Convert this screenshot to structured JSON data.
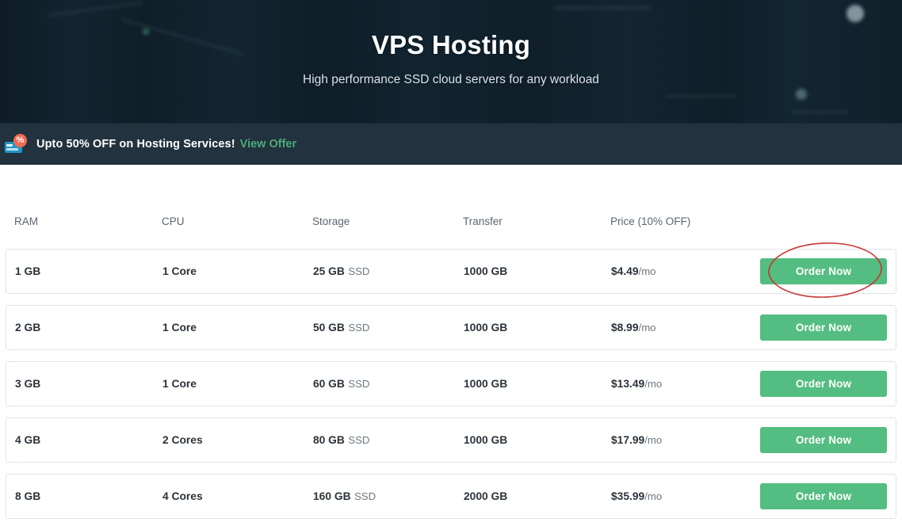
{
  "hero": {
    "title": "VPS Hosting",
    "subtitle": "High performance SSD cloud servers for any workload"
  },
  "promo": {
    "icon": "discount-card-icon",
    "text": "Upto 50% OFF on Hosting Services!",
    "link_label": "View Offer",
    "link_color": "#4aab7c"
  },
  "table": {
    "headers": {
      "ram": "RAM",
      "cpu": "CPU",
      "storage": "Storage",
      "transfer": "Transfer",
      "price": "Price (10% OFF)"
    },
    "rows": [
      {
        "ram": "1 GB",
        "cpu": "1 Core",
        "storage_amount": "25 GB",
        "storage_type": "SSD",
        "transfer": "1000 GB",
        "price": "$4.49",
        "price_period": "/mo",
        "action": "Order Now"
      },
      {
        "ram": "2 GB",
        "cpu": "1 Core",
        "storage_amount": "50 GB",
        "storage_type": "SSD",
        "transfer": "1000 GB",
        "price": "$8.99",
        "price_period": "/mo",
        "action": "Order Now"
      },
      {
        "ram": "3 GB",
        "cpu": "1 Core",
        "storage_amount": "60 GB",
        "storage_type": "SSD",
        "transfer": "1000 GB",
        "price": "$13.49",
        "price_period": "/mo",
        "action": "Order Now"
      },
      {
        "ram": "4 GB",
        "cpu": "2 Cores",
        "storage_amount": "80 GB",
        "storage_type": "SSD",
        "transfer": "1000 GB",
        "price": "$17.99",
        "price_period": "/mo",
        "action": "Order Now"
      },
      {
        "ram": "8 GB",
        "cpu": "4 Cores",
        "storage_amount": "160 GB",
        "storage_type": "SSD",
        "transfer": "2000 GB",
        "price": "$35.99",
        "price_period": "/mo",
        "action": "Order Now"
      }
    ]
  },
  "annotation": {
    "shape": "ellipse",
    "color": "#c8312f",
    "target": "first-row-order-now-button"
  },
  "colors": {
    "button_green": "#54bd82",
    "hero_background": "#16303e",
    "promo_background": "#22323e",
    "row_border": "#dde4ec"
  }
}
